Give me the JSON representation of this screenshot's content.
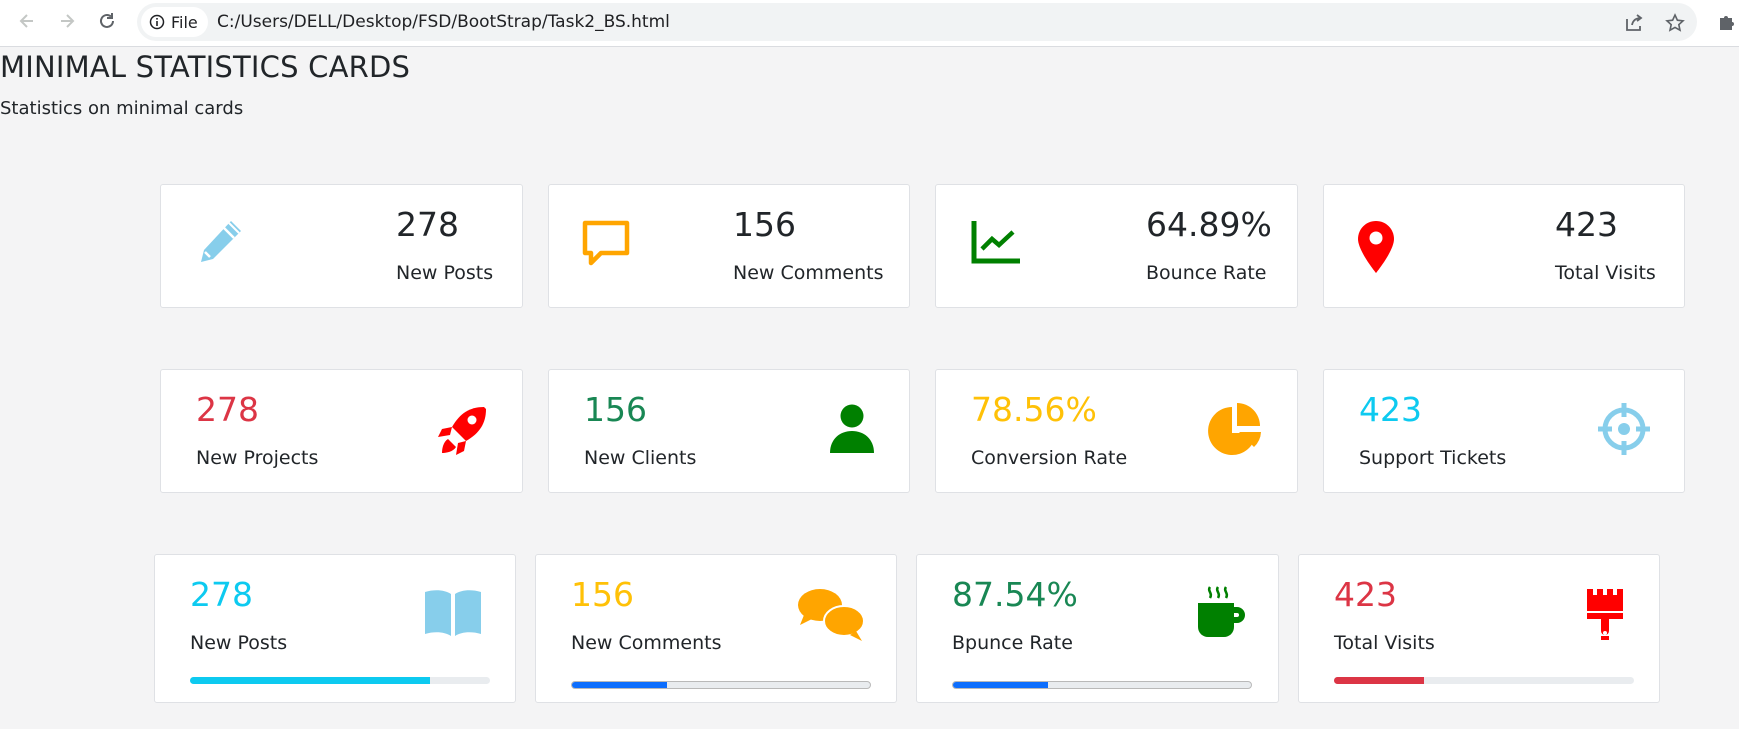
{
  "browser": {
    "chip_label": "File",
    "url": "C:/Users/DELL/Desktop/FSD/BootStrap/Task2_BS.html"
  },
  "page": {
    "title": "MINIMAL STATISTICS CARDS",
    "subtitle": "Statistics on minimal cards"
  },
  "row1": [
    {
      "value": "278",
      "label": "New Posts",
      "icon": "pencil-icon",
      "icon_color": "#87ceeb"
    },
    {
      "value": "156",
      "label": "New Comments",
      "icon": "comment-icon",
      "icon_color": "#ffa500"
    },
    {
      "value": "64.89%",
      "label": "Bounce Rate",
      "icon": "line-chart-icon",
      "icon_color": "#008000"
    },
    {
      "value": "423",
      "label": "Total Visits",
      "icon": "map-pin-icon",
      "icon_color": "#ff0000"
    }
  ],
  "row2": [
    {
      "value": "278",
      "label": "New Projects",
      "icon": "rocket-icon",
      "value_color": "#dc3545",
      "icon_color": "#ff0000"
    },
    {
      "value": "156",
      "label": "New Clients",
      "icon": "user-icon",
      "value_color": "#198754",
      "icon_color": "#008000"
    },
    {
      "value": "78.56%",
      "label": "Conversion Rate",
      "icon": "pie-chart-icon",
      "value_color": "#ffc107",
      "icon_color": "#ffa500"
    },
    {
      "value": "423",
      "label": "Support Tickets",
      "icon": "crosshairs-icon",
      "value_color": "#0dcaf0",
      "icon_color": "#87ceeb"
    }
  ],
  "row3": [
    {
      "value": "278",
      "label": "New Posts",
      "icon": "book-icon",
      "value_color": "#0dcaf0",
      "icon_color": "#87ceeb",
      "bar_color": "#0dcaf0",
      "progress": 0.8
    },
    {
      "value": "156",
      "label": "New Comments",
      "icon": "comments-icon",
      "value_color": "#ffc107",
      "icon_color": "#ffa500",
      "bar_color": "#0d6efd",
      "progress": 0.32
    },
    {
      "value": "87.54%",
      "label": "Bpunce Rate",
      "icon": "coffee-cup-icon",
      "value_color": "#198754",
      "icon_color": "#008000",
      "bar_color": "#0d6efd",
      "progress": 0.32
    },
    {
      "value": "423",
      "label": "Total Visits",
      "icon": "paint-brush-icon",
      "value_color": "#dc3545",
      "icon_color": "#ff0000",
      "bar_color": "#dc3545",
      "progress": 0.3
    }
  ]
}
